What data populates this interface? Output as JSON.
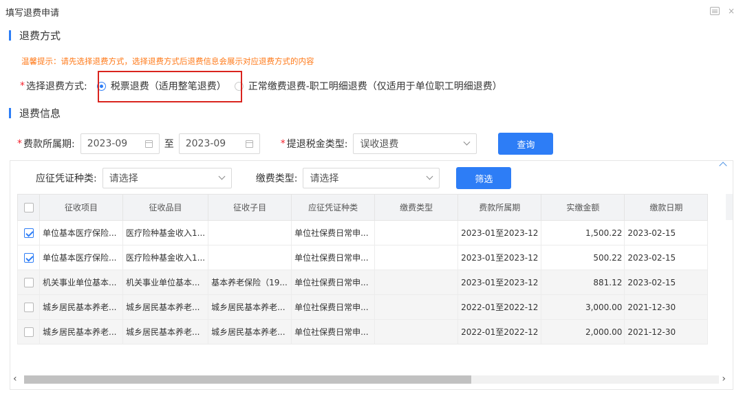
{
  "window": {
    "title": "填写退费申请"
  },
  "sections": {
    "method": "退费方式",
    "info": "退费信息"
  },
  "tip": "温馨提示：请先选择退费方式，选择退费方式后退费信息会展示对应退费方式的内容",
  "method": {
    "label": "选择退费方式:",
    "options": [
      {
        "label": "税票退费（适用整笔退费）",
        "selected": true
      },
      {
        "label": "正常缴费退费-职工明细退费（仅适用于单位职工明细退费）",
        "selected": false
      }
    ]
  },
  "filters": {
    "period_label": "费款所属期:",
    "period_from": "2023-09",
    "to": "至",
    "period_to": "2023-09",
    "tax_type_label": "提退税金类型:",
    "tax_type_value": "误收退费",
    "query_button": "查询"
  },
  "sub_filters": {
    "voucher_label": "应征凭证种类:",
    "voucher_value": "请选择",
    "pay_type_label": "缴费类型:",
    "pay_type_value": "请选择",
    "filter_button": "筛选"
  },
  "table": {
    "headers": [
      "征收项目",
      "征收品目",
      "征收子目",
      "应征凭证种类",
      "缴费类型",
      "费款所属期",
      "实缴金额",
      "缴款日期"
    ],
    "rows": [
      {
        "checked": true,
        "cells": [
          "单位基本医疗保险...",
          "医疗险种基金收入1...",
          "",
          "单位社保费日常申...",
          "",
          "2023-01至2023-12",
          "1,500.22",
          "2023-02-15"
        ]
      },
      {
        "checked": true,
        "cells": [
          "单位基本医疗保险...",
          "医疗险种基金收入1...",
          "",
          "单位社保费日常申...",
          "",
          "2023-01至2023-12",
          "500.22",
          "2023-02-15"
        ]
      },
      {
        "checked": false,
        "cells": [
          "机关事业单位基本...",
          "机关事业单位基本...",
          "基本养老保险（19...",
          "单位社保费日常申...",
          "",
          "2023-01至2023-12",
          "881.12",
          "2023-02-15"
        ]
      },
      {
        "checked": false,
        "cells": [
          "城乡居民基本养老...",
          "城乡居民基本养老...",
          "城乡居民基本养老...",
          "单位社保费日常申...",
          "",
          "2022-01至2022-12",
          "3,000.00",
          "2021-12-30"
        ]
      },
      {
        "checked": false,
        "cells": [
          "城乡居民基本养老...",
          "城乡居民基本养老...",
          "城乡居民基本养老...",
          "单位社保费日常申...",
          "",
          "2022-01至2022-12",
          "2,000.00",
          "2021-12-30"
        ]
      }
    ]
  },
  "colors": {
    "accent": "#2d7df6",
    "tip": "#ff7a1a",
    "required": "#f5222d",
    "highlight": "#d9231d"
  }
}
